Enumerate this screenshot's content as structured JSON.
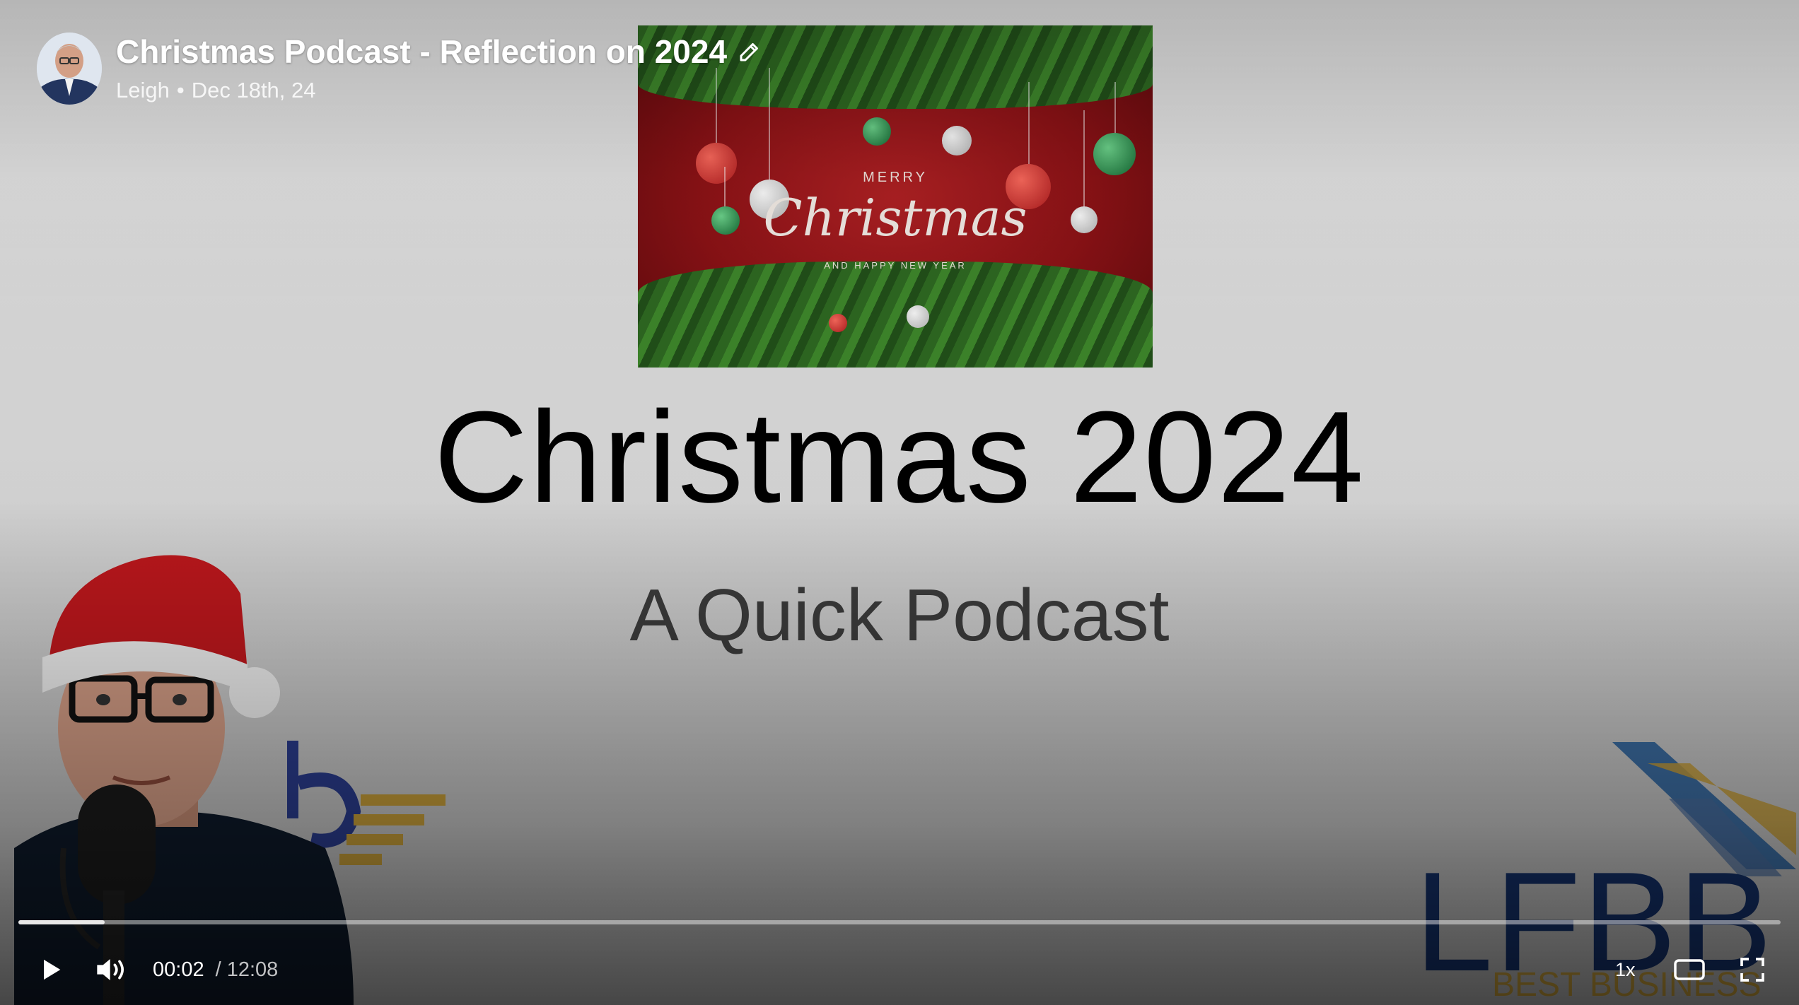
{
  "header": {
    "title": "Christmas Podcast - Reflection on 2024",
    "author": "Leigh",
    "separator": "•",
    "date": "Dec 18th, 24",
    "edit_icon": "pencil-icon",
    "avatar": "author-avatar"
  },
  "slide": {
    "card_merry": "MERRY",
    "card_christmas": "Christmas",
    "card_newyear": "AND HAPPY NEW YEAR",
    "title": "Christmas 2024",
    "subtitle": "A Quick Podcast",
    "logo_right_letters": "LFBB",
    "logo_right_small": "BEST BUSINESS"
  },
  "player": {
    "current_time": "00:02",
    "duration": "/ 12:08",
    "progress_fraction": 0.049,
    "speed": "1x",
    "play_icon": "play-icon",
    "volume_icon": "volume-icon",
    "theater_icon": "theater-mode-icon",
    "fullscreen_icon": "fullscreen-icon"
  },
  "colors": {
    "card_red": "#9b171a",
    "garland_green": "#2f6b22",
    "logo_blue": "#15326c",
    "logo_gold": "#c9a03a"
  }
}
